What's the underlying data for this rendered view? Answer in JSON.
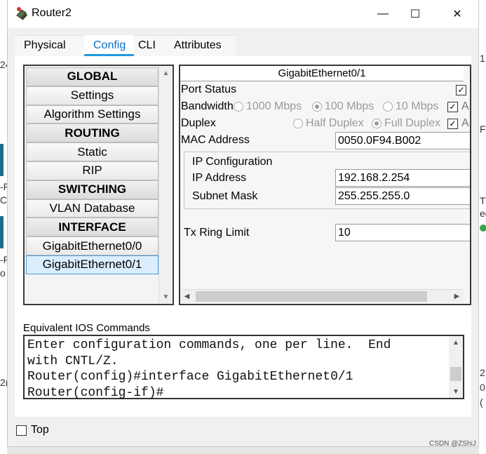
{
  "window": {
    "title": "Router2",
    "controls": {
      "minimize": "—",
      "maximize": "☐",
      "close": "✕"
    }
  },
  "tabs": [
    {
      "label": "Physical",
      "active": false
    },
    {
      "label": "Config",
      "active": true
    },
    {
      "label": "CLI",
      "active": false
    },
    {
      "label": "Attributes",
      "active": false
    }
  ],
  "nav": {
    "items": [
      {
        "label": "GLOBAL",
        "kind": "header"
      },
      {
        "label": "Settings",
        "kind": "item"
      },
      {
        "label": "Algorithm Settings",
        "kind": "item"
      },
      {
        "label": "ROUTING",
        "kind": "header"
      },
      {
        "label": "Static",
        "kind": "item"
      },
      {
        "label": "RIP",
        "kind": "item"
      },
      {
        "label": "SWITCHING",
        "kind": "header"
      },
      {
        "label": "VLAN Database",
        "kind": "item"
      },
      {
        "label": "INTERFACE",
        "kind": "header"
      },
      {
        "label": "GigabitEthernet0/0",
        "kind": "item"
      },
      {
        "label": "GigabitEthernet0/1",
        "kind": "item",
        "selected": true
      }
    ]
  },
  "detail": {
    "title": "GigabitEthernet0/1",
    "port_status_label": "Port Status",
    "port_status_checked": true,
    "bandwidth_label": "Bandwidth",
    "bandwidth_options": [
      "1000 Mbps",
      "100 Mbps",
      "10 Mbps"
    ],
    "bandwidth_selected": "100 Mbps",
    "bandwidth_auto_checked": true,
    "duplex_label": "Duplex",
    "duplex_options": [
      "Half Duplex",
      "Full Duplex"
    ],
    "duplex_selected": "Full Duplex",
    "duplex_auto_checked": true,
    "mac_label": "MAC Address",
    "mac_value": "0050.0F94.B002",
    "ip_config_label": "IP Configuration",
    "ip_address_label": "IP Address",
    "ip_address_value": "192.168.2.254",
    "subnet_mask_label": "Subnet Mask",
    "subnet_mask_value": "255.255.255.0",
    "tx_ring_label": "Tx Ring Limit",
    "tx_ring_value": "10",
    "auto_partial": "A"
  },
  "ios": {
    "label": "Equivalent IOS Commands",
    "text": "Enter configuration commands, one per line.  End\nwith CNTL/Z.\nRouter(config)#interface GigabitEthernet0/1\nRouter(config-if)#"
  },
  "footer": {
    "top_label": "Top",
    "top_checked": false
  },
  "background": {
    "left_labels": [
      "24",
      "-F",
      "CI",
      "-F",
      "o",
      "2("
    ],
    "right_labels": [
      "1",
      "F",
      "T",
      "eg",
      "2",
      "0",
      "("
    ],
    "watermark": "CSDN @ZShiJ"
  }
}
